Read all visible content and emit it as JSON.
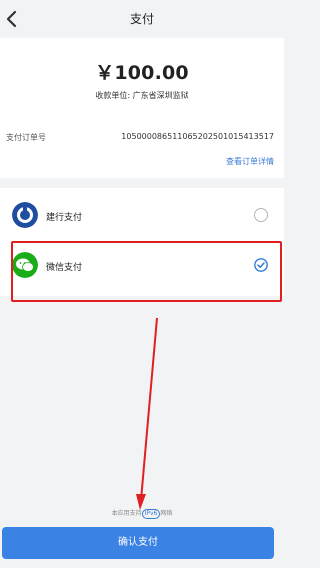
{
  "header": {
    "title": "支付",
    "back_icon": "chevron-left-icon"
  },
  "summary": {
    "amount": "￥100.00",
    "payee": "收款单位: 广东省深圳监狱",
    "order_label": "支付订单号",
    "order_number": "105000086511065202501015413517",
    "order_details_link": "查看订单详情"
  },
  "methods": [
    {
      "label": "建行支付",
      "icon": "ccb-logo-icon",
      "selected": false
    },
    {
      "label": "微信支付",
      "icon": "wechat-logo-icon",
      "selected": true
    }
  ],
  "notice": {
    "prefix": "本应用支持",
    "badge": "IPv6",
    "suffix": "网络"
  },
  "confirm_button": "确认支付",
  "colors": {
    "accent": "#3a82e4",
    "highlight": "#e02020",
    "wechat": "#1aad19",
    "ccb": "#1f4ea0"
  }
}
